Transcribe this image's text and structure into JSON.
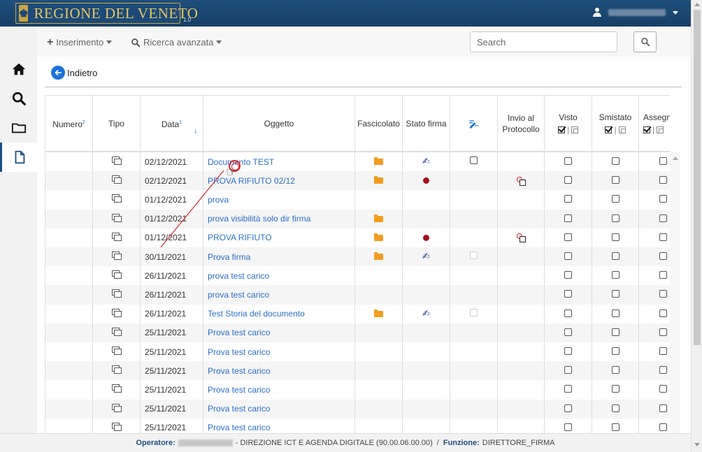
{
  "header": {
    "brand": "REGIONE DEL VENETO",
    "version": "1.0",
    "user_icon": "user-icon"
  },
  "sidebar": {
    "items": [
      {
        "name": "home",
        "icon": "home-icon"
      },
      {
        "name": "search",
        "icon": "search-icon"
      },
      {
        "name": "folder",
        "icon": "folder-icon"
      },
      {
        "name": "document",
        "icon": "document-icon",
        "active": true
      }
    ]
  },
  "toolbar": {
    "insert_label": "Inserimento",
    "advanced_search_label": "Ricerca avanzata",
    "search_placeholder": "Search"
  },
  "back_label": "Indietro",
  "table": {
    "columns": {
      "numero": "Numero",
      "numero_sup": "2",
      "tipo": "Tipo",
      "data": "Data",
      "data_sup": "1",
      "oggetto": "Oggetto",
      "fascicolato": "Fascicolato",
      "stato_firma": "Stato firma",
      "invio_line1": "Invio al",
      "invio_line2": "Protocollo",
      "visto": "Visto",
      "smistato": "Smistato",
      "assegn": "Assegn"
    },
    "rows": [
      {
        "date": "02/12/2021",
        "subject": "Documento TEST",
        "folder": true,
        "sign": "signed",
        "check": "enabled",
        "proto": false
      },
      {
        "date": "02/12/2021",
        "subject": "PROVA RIFIUTO 02/12",
        "folder": true,
        "sign": "rejected",
        "check": "none",
        "proto": true
      },
      {
        "date": "01/12/2021",
        "subject": "prova",
        "folder": false,
        "sign": "none",
        "check": "none",
        "proto": false
      },
      {
        "date": "01/12/2021",
        "subject": "prova visibilità solo dir firma",
        "folder": true,
        "sign": "none",
        "check": "none",
        "proto": false
      },
      {
        "date": "01/12/2021",
        "subject": "PROVA RIFIUTO",
        "folder": true,
        "sign": "rejected",
        "check": "none",
        "proto": true
      },
      {
        "date": "30/11/2021",
        "subject": "Prova firma",
        "folder": true,
        "sign": "signed",
        "check": "disabled",
        "proto": false
      },
      {
        "date": "26/11/2021",
        "subject": "prova test carico",
        "folder": false,
        "sign": "none",
        "check": "none",
        "proto": false
      },
      {
        "date": "26/11/2021",
        "subject": "prova test carico",
        "folder": false,
        "sign": "none",
        "check": "none",
        "proto": false
      },
      {
        "date": "26/11/2021",
        "subject": "Test Storia del documento",
        "folder": true,
        "sign": "signed",
        "check": "disabled",
        "proto": false
      },
      {
        "date": "25/11/2021",
        "subject": "Prova test carico",
        "folder": false,
        "sign": "none",
        "check": "none",
        "proto": false
      },
      {
        "date": "25/11/2021",
        "subject": "Prova test carico",
        "folder": false,
        "sign": "none",
        "check": "none",
        "proto": false
      },
      {
        "date": "25/11/2021",
        "subject": "Prova test carico",
        "folder": false,
        "sign": "none",
        "check": "none",
        "proto": false
      },
      {
        "date": "25/11/2021",
        "subject": "Prova test carico",
        "folder": false,
        "sign": "none",
        "check": "none",
        "proto": false
      },
      {
        "date": "25/11/2021",
        "subject": "Prova test carico",
        "folder": false,
        "sign": "none",
        "check": "none",
        "proto": false
      },
      {
        "date": "25/11/2021",
        "subject": "Prova test carico",
        "folder": false,
        "sign": "none",
        "check": "none",
        "proto": false
      }
    ]
  },
  "footer": {
    "operator_label": "Operatore:",
    "department": "- DIREZIONE ICT E AGENDA DIGITALE (90.00.06.00.00)",
    "separator": "/",
    "function_label": "Funzione:",
    "function_value": "DIRETTORE_FIRMA"
  },
  "colors": {
    "header_bg": "#1f4f7d",
    "brand_gold": "#e7c763",
    "link": "#2a6fc9",
    "folder": "#f29c1f",
    "accent": "#1a73d9"
  }
}
